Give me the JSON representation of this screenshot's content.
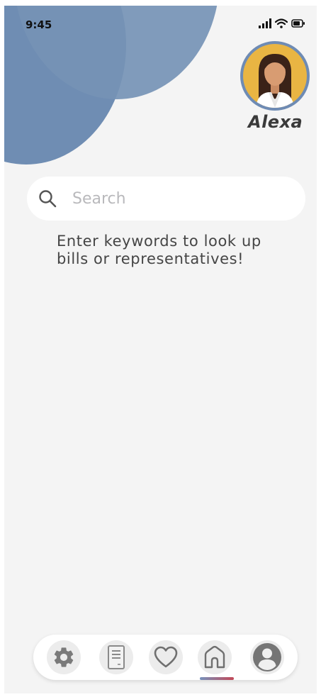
{
  "status_bar": {
    "time": "9:45",
    "icons": [
      "cellular-signal-icon",
      "wifi-icon",
      "battery-icon"
    ]
  },
  "profile": {
    "name": "Alexa",
    "avatar_icon": "woman-avatar-icon"
  },
  "search": {
    "placeholder": "Search",
    "value": ""
  },
  "hint": {
    "text": "Enter keywords to look up bills or representatives!"
  },
  "bottom_nav": {
    "items": [
      {
        "id": "settings",
        "icon": "gear-icon"
      },
      {
        "id": "bills",
        "icon": "document-icon"
      },
      {
        "id": "favorites",
        "icon": "heart-icon"
      },
      {
        "id": "home",
        "icon": "home-icon",
        "active": true
      },
      {
        "id": "profile",
        "icon": "user-icon"
      }
    ]
  },
  "colors": {
    "background": "#f4f4f4",
    "accent_blue": "#6f8db3",
    "avatar_bg": "#e9b543",
    "indicator_start": "#7691bb",
    "indicator_end": "#c24857"
  }
}
